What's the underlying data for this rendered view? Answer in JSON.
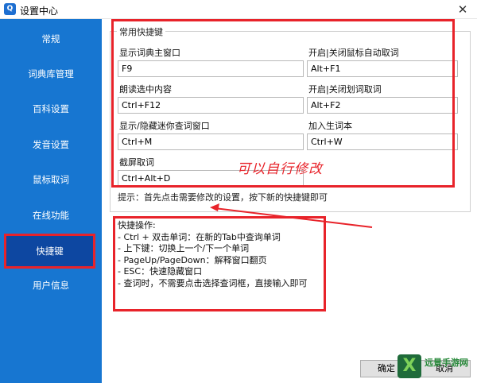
{
  "window": {
    "title": "设置中心",
    "app_icon_text": "Q",
    "close_glyph": "✕"
  },
  "sidebar": {
    "items": [
      {
        "label": "常规"
      },
      {
        "label": "词典库管理"
      },
      {
        "label": "百科设置"
      },
      {
        "label": "发音设置"
      },
      {
        "label": "鼠标取词"
      },
      {
        "label": "在线功能"
      },
      {
        "label": "快捷键",
        "active": true
      },
      {
        "label": "用户信息"
      }
    ]
  },
  "hotkeys": {
    "group_title": "常用快捷键",
    "fields": [
      {
        "label": "显示词典主窗口",
        "value": "F9"
      },
      {
        "label": "开启|关闭鼠标自动取词",
        "value": "Alt+F1"
      },
      {
        "label": "朗读选中内容",
        "value": "Ctrl+F12"
      },
      {
        "label": "开启|关闭划词取词",
        "value": "Alt+F2"
      },
      {
        "label": "显示/隐藏迷你查词窗口",
        "value": "Ctrl+M"
      },
      {
        "label": "加入生词本",
        "value": "Ctrl+W"
      },
      {
        "label": "截屏取词",
        "value": "Ctrl+Alt+D"
      }
    ]
  },
  "annotation": "可以自行修改",
  "hint": "提示：首先点击需要修改的设置，按下新的快捷键即可",
  "tips": {
    "title": "快捷操作:",
    "lines": [
      "- Ctrl + 双击单词：在新的Tab中查询单词",
      "- 上下键：切换上一个/下一个单词",
      "- PageUp/PageDown：解释窗口翻页",
      "- ESC：快速隐藏窗口",
      "- 查词时，不需要点击选择查词框，直接输入即可"
    ]
  },
  "buttons": {
    "ok": "确定",
    "cancel": "取消"
  },
  "watermark": {
    "logo": "X",
    "text": "远景手游网"
  },
  "colors": {
    "sidebar": "#1776d1",
    "sidebar_active": "#0d47a1",
    "annotation_red": "#e8232a"
  }
}
